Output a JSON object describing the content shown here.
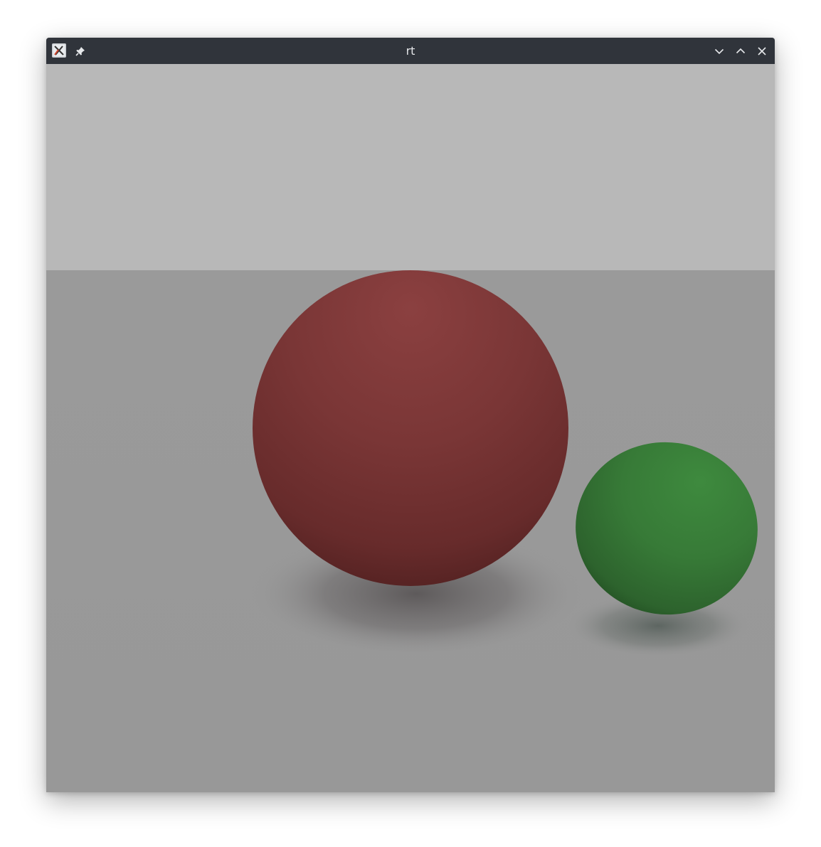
{
  "window": {
    "title": "rt",
    "buttons": {
      "app_icon": "x-app-icon",
      "pin": "pin-icon",
      "minimize": "chevron-down-icon",
      "maximize": "chevron-up-icon",
      "close": "close-icon"
    }
  },
  "colors": {
    "titlebar": "#30343b",
    "title_text": "#e6e8eb",
    "sky": "#b8b8b8",
    "floor": "#989898",
    "red_sphere": "#7a3535",
    "green_sphere": "#3a7c3a"
  },
  "scene": {
    "objects": [
      {
        "name": "red-sphere",
        "color": "#7a3535"
      },
      {
        "name": "green-sphere",
        "color": "#3a7c3a"
      }
    ]
  }
}
